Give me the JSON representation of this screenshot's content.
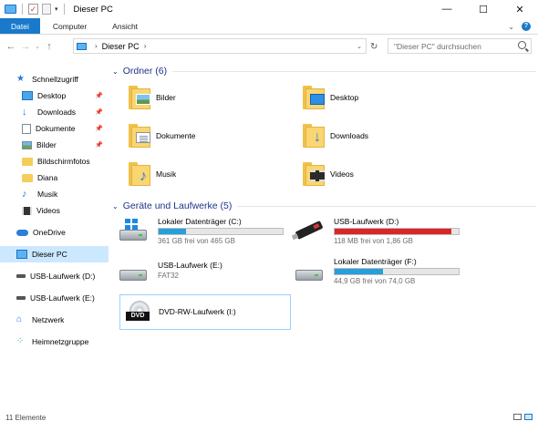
{
  "window": {
    "title": "Dieser PC",
    "controls": {
      "minimize": "—",
      "maximize": "☐",
      "close": "✕"
    }
  },
  "ribbon": {
    "tabs": [
      {
        "label": "Datei",
        "active": true
      },
      {
        "label": "Computer",
        "active": false
      },
      {
        "label": "Ansicht",
        "active": false
      }
    ]
  },
  "address": {
    "path": "Dieser PC",
    "search_placeholder": "\"Dieser PC\" durchsuchen"
  },
  "sidebar": {
    "items": [
      {
        "label": "Schnellzugriff",
        "icon": "star-icon",
        "level": 0,
        "pinned": false
      },
      {
        "label": "Desktop",
        "icon": "desktop-icon",
        "level": 1,
        "pinned": true
      },
      {
        "label": "Downloads",
        "icon": "download-icon",
        "level": 1,
        "pinned": true
      },
      {
        "label": "Dokumente",
        "icon": "document-icon",
        "level": 1,
        "pinned": true
      },
      {
        "label": "Bilder",
        "icon": "pictures-icon",
        "level": 1,
        "pinned": true
      },
      {
        "label": "Bildschirmfotos",
        "icon": "folder-icon",
        "level": 1,
        "pinned": false
      },
      {
        "label": "Diana",
        "icon": "folder-icon",
        "level": 1,
        "pinned": false
      },
      {
        "label": "Musik",
        "icon": "music-icon",
        "level": 1,
        "pinned": false
      },
      {
        "label": "Videos",
        "icon": "video-icon",
        "level": 1,
        "pinned": false
      },
      {
        "label": "OneDrive",
        "icon": "cloud-icon",
        "level": 0,
        "pinned": false
      },
      {
        "label": "Dieser PC",
        "icon": "pc-icon",
        "level": 0,
        "pinned": false,
        "selected": true
      },
      {
        "label": "USB-Laufwerk (D:)",
        "icon": "usb-icon",
        "level": 0,
        "pinned": false
      },
      {
        "label": "USB-Laufwerk (E:)",
        "icon": "usb-icon",
        "level": 0,
        "pinned": false
      },
      {
        "label": "Netzwerk",
        "icon": "network-icon",
        "level": 0,
        "pinned": false
      },
      {
        "label": "Heimnetzgruppe",
        "icon": "homegroup-icon",
        "level": 0,
        "pinned": false
      }
    ]
  },
  "folders": {
    "header": "Ordner (6)",
    "items": [
      {
        "label": "Bilder",
        "icon": "pictures-folder-icon"
      },
      {
        "label": "Desktop",
        "icon": "desktop-folder-icon"
      },
      {
        "label": "Dokumente",
        "icon": "documents-folder-icon"
      },
      {
        "label": "Downloads",
        "icon": "downloads-folder-icon"
      },
      {
        "label": "Musik",
        "icon": "music-folder-icon"
      },
      {
        "label": "Videos",
        "icon": "videos-folder-icon"
      }
    ]
  },
  "drives": {
    "header": "Geräte und Laufwerke (5)",
    "items": [
      {
        "label": "Lokaler Datenträger (C:)",
        "info": "361 GB frei von 465 GB",
        "used_fraction": 0.22,
        "full": false,
        "type": "system-drive-icon"
      },
      {
        "label": "USB-Laufwerk (D:)",
        "info": "118 MB frei von 1,86 GB",
        "used_fraction": 0.94,
        "full": true,
        "type": "usb-stick-icon"
      },
      {
        "label": "USB-Laufwerk (E:)",
        "info": "FAT32",
        "type": "usb-drive-icon"
      },
      {
        "label": "Lokaler Datenträger (F:)",
        "info": "44,9 GB frei von 74,0 GB",
        "used_fraction": 0.39,
        "full": false,
        "type": "hard-drive-icon"
      },
      {
        "label": "DVD-RW-Laufwerk (I:)",
        "info": "",
        "type": "dvd-drive-icon",
        "dvd_text": "DVD"
      }
    ]
  },
  "status": {
    "text": "11 Elemente"
  }
}
